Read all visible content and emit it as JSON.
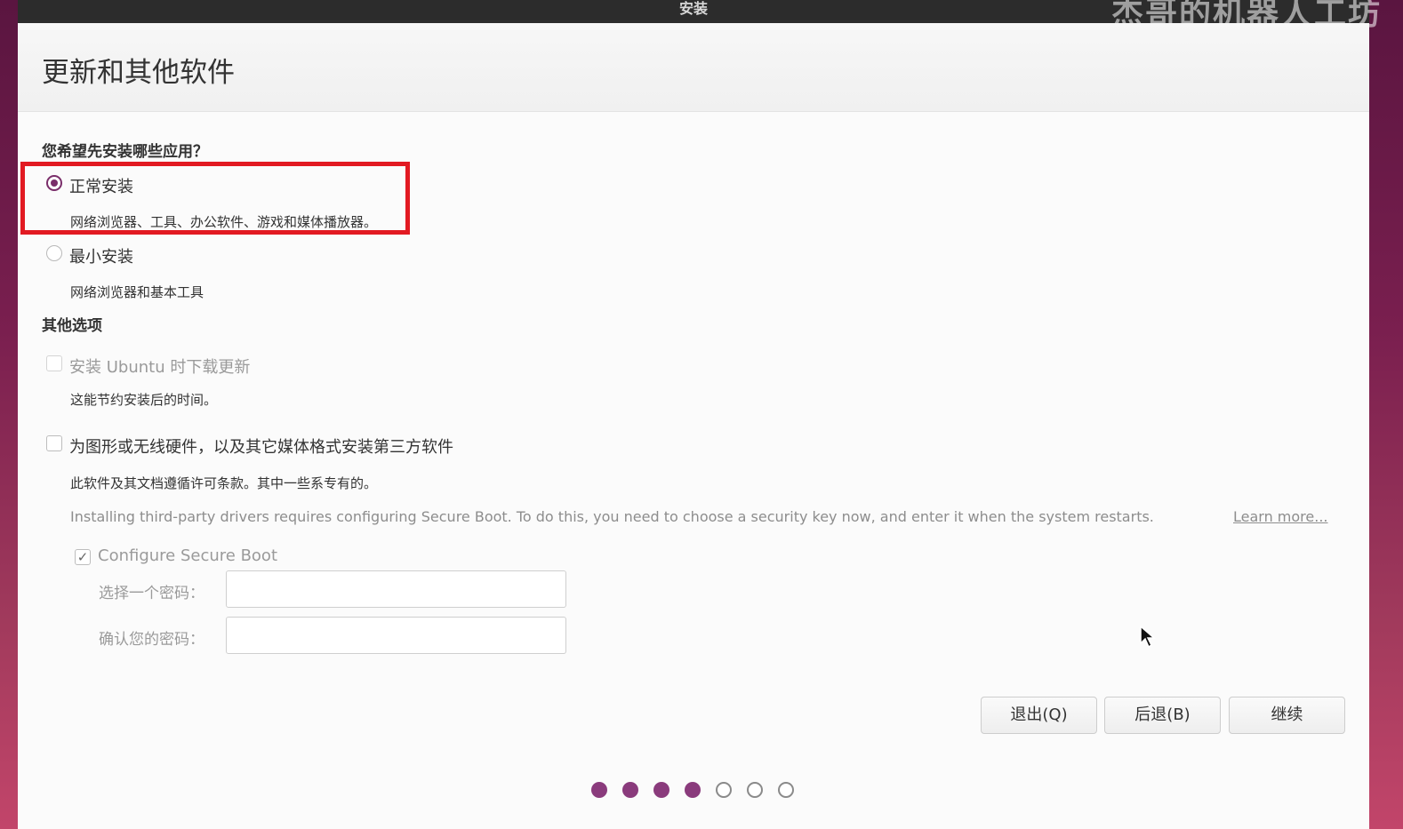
{
  "window_title": "安装",
  "watermark": "杰哥的机器人工坊",
  "page_heading": "更新和其他软件",
  "install_question": "您希望先安装哪些应用？",
  "options": {
    "normal": {
      "label": "正常安装",
      "description": "网络浏览器、工具、办公软件、游戏和媒体播放器。",
      "selected": true
    },
    "minimal": {
      "label": "最小安装",
      "description": "网络浏览器和基本工具",
      "selected": false
    }
  },
  "other_options_title": "其他选项",
  "download_updates": {
    "label": "安装 Ubuntu 时下载更新",
    "description": "这能节约安装后的时间。",
    "checked": false,
    "disabled": true
  },
  "third_party": {
    "label": "为图形或无线硬件，以及其它媒体格式安装第三方软件",
    "description": "此软件及其文档遵循许可条款。其中一些系专有的。",
    "checked": false
  },
  "secure_boot_note": "Installing third-party drivers requires configuring Secure Boot. To do this, you need to choose a security key now, and enter it when the system restarts.",
  "learn_more": "Learn more...",
  "configure_secure_boot": {
    "label": "Configure Secure Boot",
    "checked": true
  },
  "password_fields": {
    "choose_label": "选择一个密码：",
    "confirm_label": "确认您的密码：",
    "choose_value": "",
    "confirm_value": ""
  },
  "buttons": {
    "quit": "退出(Q)",
    "back": "后退(B)",
    "continue": "继续"
  },
  "progress": {
    "total_steps": 7,
    "completed_steps": 4
  },
  "colors": {
    "accent": "#7a2e6a",
    "highlight_box": "#e21a22",
    "titlebar": "#2c2c2c"
  },
  "icons": {
    "checkmark": "checkmark-icon",
    "cursor": "mouse-pointer-icon"
  }
}
